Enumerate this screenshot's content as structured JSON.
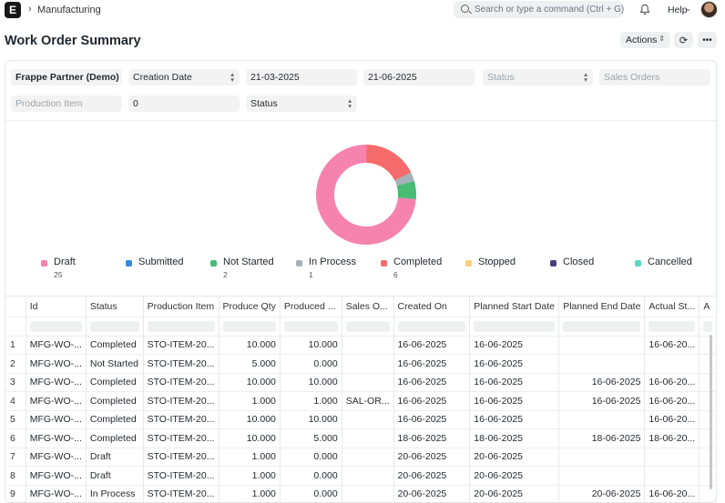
{
  "navbar": {
    "logo_letter": "E",
    "breadcrumb": "Manufacturing",
    "search_placeholder": "Search or type a command (Ctrl + G)",
    "help_label": "Help"
  },
  "page": {
    "title": "Work Order Summary",
    "actions_label": "Actions"
  },
  "filters": {
    "company": "Frappe Partner (Demo)",
    "based_on": "Creation Date",
    "from_date": "21-03-2025",
    "to_date": "21-06-2025",
    "status_placeholder": "Status",
    "sales_orders_placeholder": "Sales Orders",
    "production_item_placeholder": "Production Item",
    "age": "0",
    "status2": "Status"
  },
  "chart_data": {
    "type": "pie",
    "categories": [
      "Draft",
      "Submitted",
      "Not Started",
      "In Process",
      "Completed",
      "Stopped",
      "Closed",
      "Cancelled"
    ],
    "values": [
      25,
      0,
      2,
      1,
      6,
      0,
      0,
      0
    ],
    "colors": [
      "#f683ae",
      "#318ad8",
      "#48bb74",
      "#a6b1b9",
      "#f56b6b",
      "#facf7a",
      "#44427b",
      "#5fd8c4"
    ],
    "legend_values": [
      "25",
      "",
      "2",
      "1",
      "6",
      "",
      "",
      ""
    ]
  },
  "table": {
    "columns": [
      "Id",
      "Status",
      "Production Item",
      "Produce Qty",
      "Produced ...",
      "Sales O...",
      "Created On",
      "Planned Start Date",
      "Planned End Date",
      "Actual St...",
      "A"
    ],
    "rows": [
      [
        "1",
        "MFG-WO-...",
        "Completed",
        "STO-ITEM-20...",
        "10.000",
        "10.000",
        "",
        "16-06-2025",
        "16-06-2025",
        "",
        "16-06-20..."
      ],
      [
        "2",
        "MFG-WO-...",
        "Not Started",
        "STO-ITEM-20...",
        "5.000",
        "0.000",
        "",
        "16-06-2025",
        "16-06-2025",
        "",
        ""
      ],
      [
        "3",
        "MFG-WO-...",
        "Completed",
        "STO-ITEM-20...",
        "10.000",
        "10.000",
        "",
        "16-06-2025",
        "16-06-2025",
        "16-06-2025",
        "16-06-20..."
      ],
      [
        "4",
        "MFG-WO-...",
        "Completed",
        "STO-ITEM-20...",
        "1.000",
        "1.000",
        "SAL-OR...",
        "16-06-2025",
        "16-06-2025",
        "16-06-2025",
        "16-06-20..."
      ],
      [
        "5",
        "MFG-WO-...",
        "Completed",
        "STO-ITEM-20...",
        "10.000",
        "10.000",
        "",
        "16-06-2025",
        "16-06-2025",
        "",
        "16-06-20..."
      ],
      [
        "6",
        "MFG-WO-...",
        "Completed",
        "STO-ITEM-20...",
        "10.000",
        "5.000",
        "",
        "18-06-2025",
        "18-06-2025",
        "18-06-2025",
        "18-06-20..."
      ],
      [
        "7",
        "MFG-WO-...",
        "Draft",
        "STO-ITEM-20...",
        "1.000",
        "0.000",
        "",
        "20-06-2025",
        "20-06-2025",
        "",
        ""
      ],
      [
        "8",
        "MFG-WO-...",
        "Draft",
        "STO-ITEM-20...",
        "1.000",
        "0.000",
        "",
        "20-06-2025",
        "20-06-2025",
        "",
        ""
      ],
      [
        "9",
        "MFG-WO-...",
        "In Process",
        "STO-ITEM-20...",
        "1.000",
        "0.000",
        "",
        "20-06-2025",
        "20-06-2025",
        "20-06-2025",
        "16-06-20..."
      ]
    ]
  }
}
